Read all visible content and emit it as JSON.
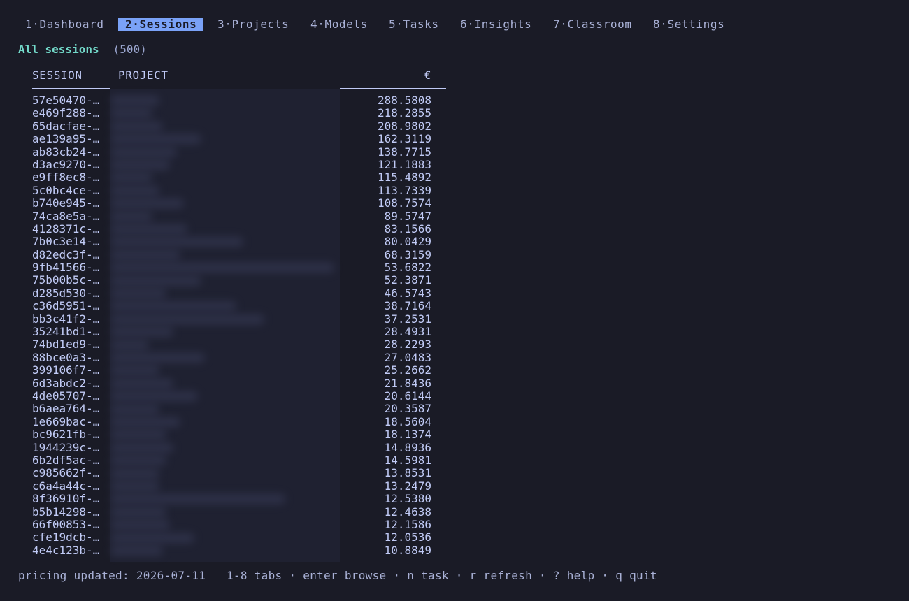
{
  "tabs": [
    {
      "label": "1·Dashboard",
      "active": false
    },
    {
      "label": "2·Sessions",
      "active": true
    },
    {
      "label": "3·Projects",
      "active": false
    },
    {
      "label": "4·Models",
      "active": false
    },
    {
      "label": "5·Tasks",
      "active": false
    },
    {
      "label": "6·Insights",
      "active": false
    },
    {
      "label": "7·Classroom",
      "active": false
    },
    {
      "label": "8·Settings",
      "active": false
    }
  ],
  "section": {
    "title": "All sessions",
    "count": "(500)"
  },
  "table": {
    "columns": [
      "SESSION",
      "PROJECT",
      "€"
    ],
    "project_values_redacted": true,
    "rows": [
      {
        "session": "57e50470-…",
        "cost": "288.5808"
      },
      {
        "session": "e469f288-…",
        "cost": "218.2855"
      },
      {
        "session": "65dacfae-…",
        "cost": "208.9802"
      },
      {
        "session": "ae139a95-…",
        "cost": "162.3119"
      },
      {
        "session": "ab83cb24-…",
        "cost": "138.7715"
      },
      {
        "session": "d3ac9270-…",
        "cost": "121.1883"
      },
      {
        "session": "e9ff8ec8-…",
        "cost": "115.4892"
      },
      {
        "session": "5c0bc4ce-…",
        "cost": "113.7339"
      },
      {
        "session": "b740e945-…",
        "cost": "108.7574"
      },
      {
        "session": "74ca8e5a-…",
        "cost": "89.5747"
      },
      {
        "session": "4128371c-…",
        "cost": "83.1566"
      },
      {
        "session": "7b0c3e14-…",
        "cost": "80.0429"
      },
      {
        "session": "d82edc3f-…",
        "cost": "68.3159"
      },
      {
        "session": "9fb41566-…",
        "cost": "53.6822"
      },
      {
        "session": "75b00b5c-…",
        "cost": "52.3871"
      },
      {
        "session": "d285d530-…",
        "cost": "46.5743"
      },
      {
        "session": "c36d5951-…",
        "cost": "38.7164"
      },
      {
        "session": "bb3c41f2-…",
        "cost": "37.2531"
      },
      {
        "session": "35241bd1-…",
        "cost": "28.4931"
      },
      {
        "session": "74bd1ed9-…",
        "cost": "28.2293"
      },
      {
        "session": "88bce0a3-…",
        "cost": "27.0483"
      },
      {
        "session": "399106f7-…",
        "cost": "25.2662"
      },
      {
        "session": "6d3abdc2-…",
        "cost": "21.8436"
      },
      {
        "session": "4de05707-…",
        "cost": "20.6144"
      },
      {
        "session": "b6aea764-…",
        "cost": "20.3587"
      },
      {
        "session": "1e669bac-…",
        "cost": "18.5604"
      },
      {
        "session": "bc9621fb-…",
        "cost": "18.1374"
      },
      {
        "session": "1944239c-…",
        "cost": "14.8936"
      },
      {
        "session": "6b2df5ac-…",
        "cost": "14.5981"
      },
      {
        "session": "c985662f-…",
        "cost": "13.8531"
      },
      {
        "session": "c6a4a44c-…",
        "cost": "13.2479"
      },
      {
        "session": "8f36910f-…",
        "cost": "12.5380"
      },
      {
        "session": "b5b14298-…",
        "cost": "12.4638"
      },
      {
        "session": "66f00853-…",
        "cost": "12.1586"
      },
      {
        "session": "cfe19dcb-…",
        "cost": "12.0536"
      },
      {
        "session": "4e4c123b-…",
        "cost": "10.8849"
      }
    ]
  },
  "footer": {
    "pricing": "pricing updated: 2026-07-11",
    "hints": "1-8 tabs · enter browse · n task · r refresh · ? help · q quit"
  },
  "colors": {
    "background": "#1a1b26",
    "accent": "#7aa2f7",
    "title": "#73daca",
    "text": "#c0caf5"
  }
}
